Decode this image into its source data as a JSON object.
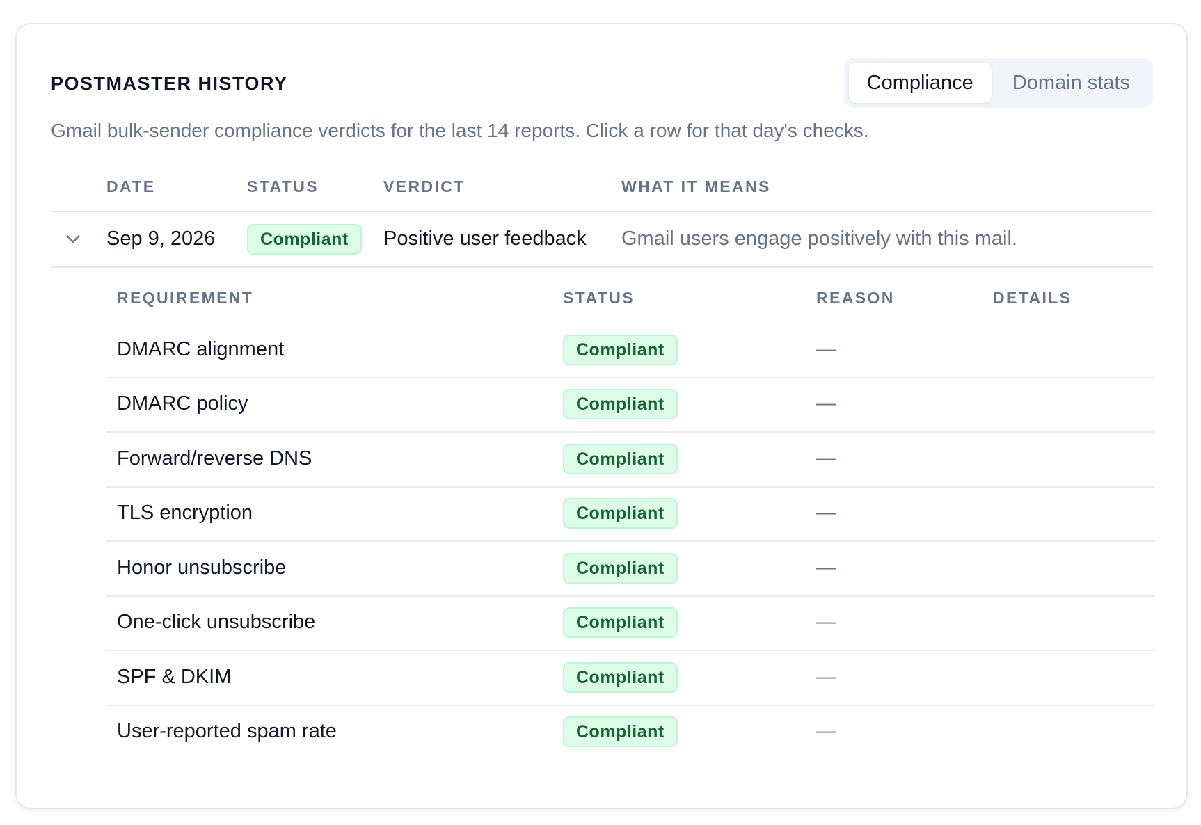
{
  "header": {
    "title": "POSTMASTER HISTORY",
    "subtitle": "Gmail bulk-sender compliance verdicts for the last 14 reports. Click a row for that day's checks."
  },
  "tabs": [
    {
      "label": "Compliance",
      "active": true
    },
    {
      "label": "Domain stats",
      "active": false
    }
  ],
  "table": {
    "columns": [
      "DATE",
      "STATUS",
      "VERDICT",
      "WHAT IT MEANS"
    ],
    "rows": [
      {
        "date": "Sep 9, 2026",
        "status": "Compliant",
        "verdict": "Positive user feedback",
        "meaning": "Gmail users engage positively with this mail.",
        "expanded": true
      }
    ]
  },
  "details": {
    "columns": [
      "REQUIREMENT",
      "STATUS",
      "REASON",
      "DETAILS"
    ],
    "rows": [
      {
        "requirement": "DMARC alignment",
        "status": "Compliant",
        "reason": "—",
        "details": ""
      },
      {
        "requirement": "DMARC policy",
        "status": "Compliant",
        "reason": "—",
        "details": ""
      },
      {
        "requirement": "Forward/reverse DNS",
        "status": "Compliant",
        "reason": "—",
        "details": ""
      },
      {
        "requirement": "TLS encryption",
        "status": "Compliant",
        "reason": "—",
        "details": ""
      },
      {
        "requirement": "Honor unsubscribe",
        "status": "Compliant",
        "reason": "—",
        "details": ""
      },
      {
        "requirement": "One-click unsubscribe",
        "status": "Compliant",
        "reason": "—",
        "details": ""
      },
      {
        "requirement": "SPF & DKIM",
        "status": "Compliant",
        "reason": "—",
        "details": ""
      },
      {
        "requirement": "User-reported spam rate",
        "status": "Compliant",
        "reason": "—",
        "details": ""
      }
    ]
  },
  "colors": {
    "badge_bg": "#dcfce7",
    "badge_border": "#bbf7d0",
    "badge_text": "#166534",
    "muted_text": "#64748b",
    "primary_text": "#0f172a"
  },
  "icons": {
    "expand": "chevron-down-icon"
  }
}
